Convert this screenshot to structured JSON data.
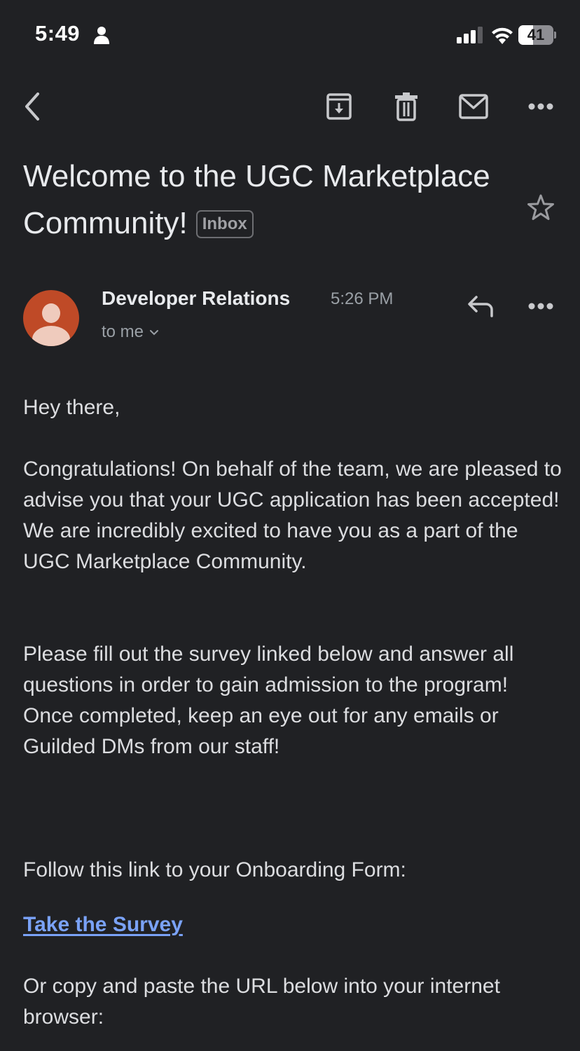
{
  "status_bar": {
    "time": "5:49",
    "battery_percent": "41",
    "battery_level": 0.41,
    "signal_bars": 3,
    "signal_bars_total": 4
  },
  "toolbar": {
    "icons": {
      "back": "chevron-left-icon",
      "archive": "archive-icon",
      "delete": "trash-icon",
      "mark_unread": "mail-icon",
      "more": "more-horizontal-icon"
    }
  },
  "email": {
    "subject": "Welcome to the UGC Marketplace Community!",
    "label": "Inbox",
    "starred": false,
    "sender": {
      "name": "Developer Relations",
      "time": "5:26 PM",
      "recipient": "to me",
      "avatar_color": "#bf4a27"
    },
    "body": {
      "greeting": "Hey there,",
      "congrats": "Congratulations! On behalf of the team, we are pleased to advise you that your UGC application has been accepted! We are incredibly excited to have you as a part of the UGC Marketplace Community.",
      "survey": "Please fill out the survey linked below and answer all questions in order to gain admission to the program! Once completed, keep an eye out for any emails or Guilded DMs from our staff!",
      "follow": "Follow this link to your Onboarding Form:",
      "link_label": "Take the Survey",
      "copy": "Or copy and paste the URL below into your internet browser:"
    }
  },
  "colors": {
    "background": "#202124",
    "link": "#7aa2f7",
    "text": "#dcdde0",
    "muted": "#9aa0a6"
  }
}
